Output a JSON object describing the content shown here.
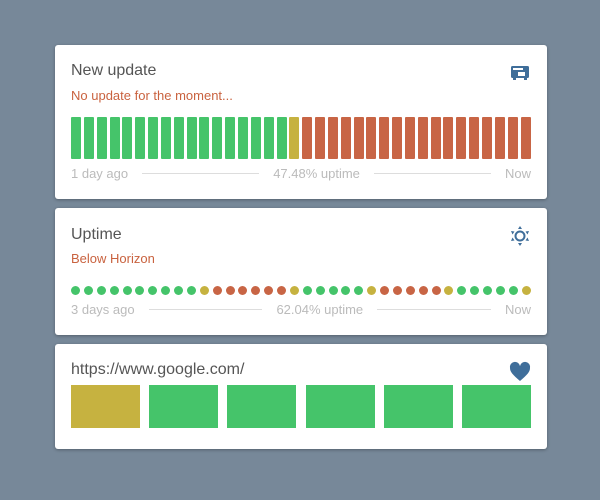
{
  "colors": {
    "up": "#45c46a",
    "partial": "#c6b240",
    "down": "#c86545",
    "icon": "#3f6e9a"
  },
  "cards": [
    {
      "title": "New update",
      "subtitle": "No update for the moment...",
      "icon": "ethernet-card-icon",
      "start": "1 day ago",
      "uptime": "47.48% uptime",
      "end": "Now",
      "beats": [
        "up",
        "up",
        "up",
        "up",
        "up",
        "up",
        "up",
        "up",
        "up",
        "up",
        "up",
        "up",
        "up",
        "up",
        "up",
        "up",
        "up",
        "partial",
        "down",
        "down",
        "down",
        "down",
        "down",
        "down",
        "down",
        "down",
        "down",
        "down",
        "down",
        "down",
        "down",
        "down",
        "down",
        "down",
        "down",
        "down"
      ]
    },
    {
      "title": "Uptime",
      "subtitle": "Below Horizon",
      "icon": "sun-icon",
      "start": "3 days ago",
      "uptime": "62.04% uptime",
      "end": "Now",
      "beats": [
        "up",
        "up",
        "up",
        "up",
        "up",
        "up",
        "up",
        "up",
        "up",
        "up",
        "partial",
        "down",
        "down",
        "down",
        "down",
        "down",
        "down",
        "partial",
        "up",
        "up",
        "up",
        "up",
        "up",
        "partial",
        "down",
        "down",
        "down",
        "down",
        "down",
        "partial",
        "up",
        "up",
        "up",
        "up",
        "up",
        "partial"
      ]
    },
    {
      "title": "https://www.google.com/",
      "icon": "heart-icon",
      "beats": [
        "partial",
        "up",
        "up",
        "up",
        "up",
        "up"
      ]
    }
  ]
}
